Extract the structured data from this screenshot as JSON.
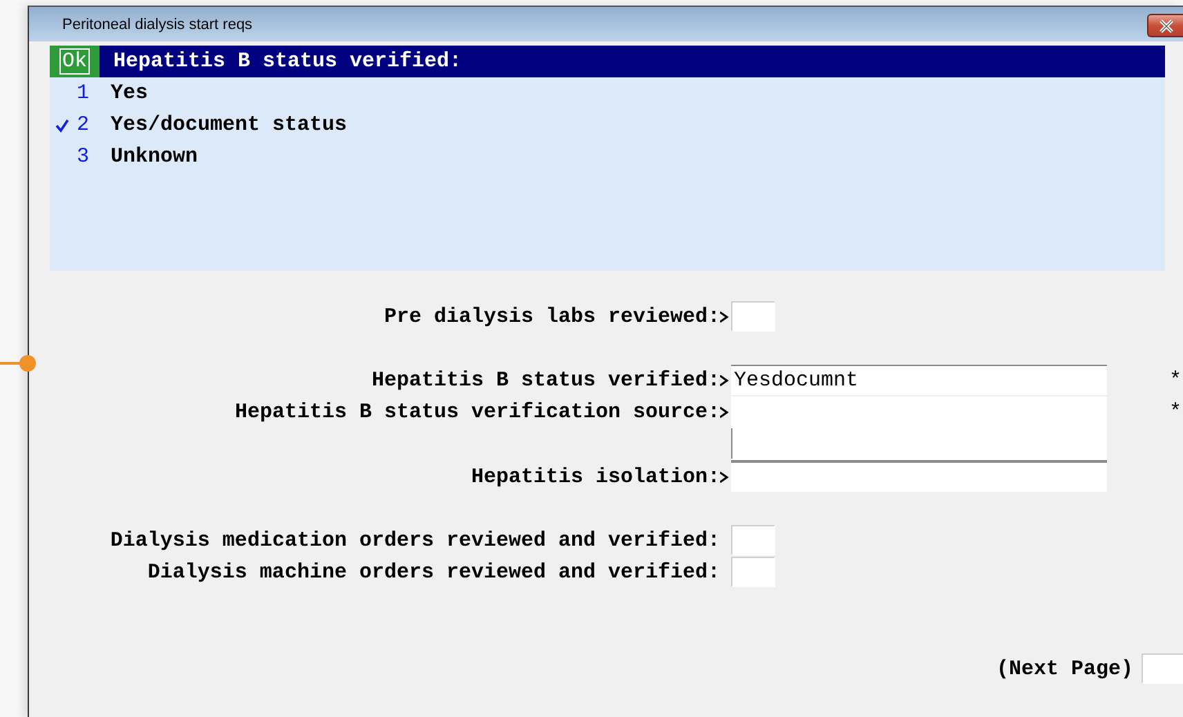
{
  "window": {
    "title": "Peritoneal dialysis start reqs"
  },
  "choice_list": {
    "ok_label": "Ok",
    "prompt": "Hepatitis B status verified:",
    "options": [
      {
        "number": "1",
        "label": "Yes",
        "checked": false
      },
      {
        "number": "2",
        "label": "Yes/document status",
        "checked": true
      },
      {
        "number": "3",
        "label": "Unknown",
        "checked": false
      }
    ]
  },
  "form_groups": [
    [
      {
        "label": "Pre dialysis labs reviewed:",
        "pointer": true,
        "kind": "box"
      }
    ],
    [
      {
        "label": "Hepatitis B status verified:",
        "pointer": true,
        "kind": "line",
        "value": "Yesdocumnt",
        "marker": "*"
      },
      {
        "label": "Hepatitis B status verification source:",
        "pointer": true,
        "kind": "multiline",
        "marker": "*"
      },
      {
        "label": "Hepatitis isolation:",
        "pointer": true,
        "kind": "line"
      }
    ],
    [
      {
        "label": "Dialysis medication orders reviewed and verified:",
        "pointer": false,
        "kind": "box"
      },
      {
        "label": "Dialysis machine orders reviewed and verified:",
        "pointer": false,
        "kind": "box"
      }
    ]
  ],
  "next_page": {
    "label": "(Next Page)"
  }
}
